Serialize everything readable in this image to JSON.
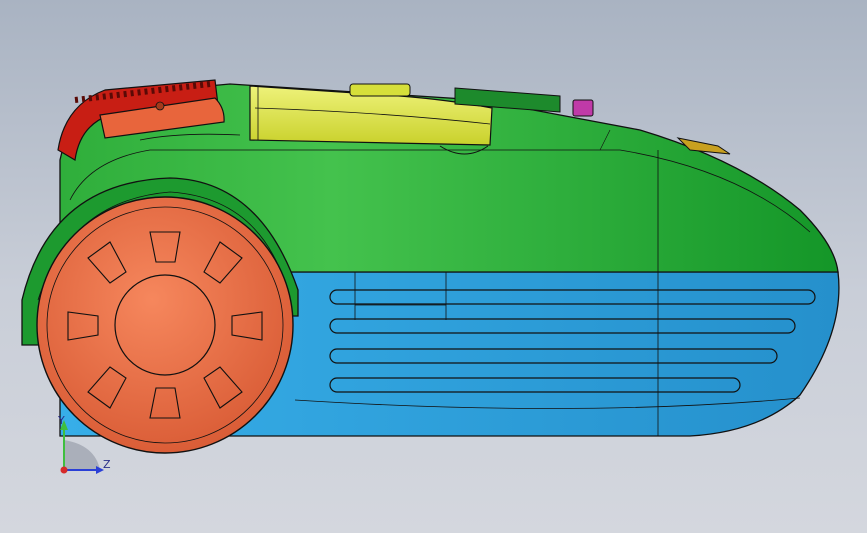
{
  "viewport": {
    "background_top": "#a9b3c2",
    "background_bottom": "#d4d7de"
  },
  "model": {
    "colors": {
      "green_light": "#3fbf4a",
      "green_dark": "#169a2a",
      "blue": "#2e9fdc",
      "yellow": "#d6df3a",
      "orange": "#f0764e",
      "red": "#c81e14",
      "magenta": "#c03aa8",
      "gold": "#c8a020",
      "edge": "#111111"
    }
  },
  "triad": {
    "y_label": "Y",
    "z_label": "Z",
    "y_color": "#3fbf3f",
    "z_color": "#2a3fd6",
    "origin_color": "#d62a2a"
  }
}
